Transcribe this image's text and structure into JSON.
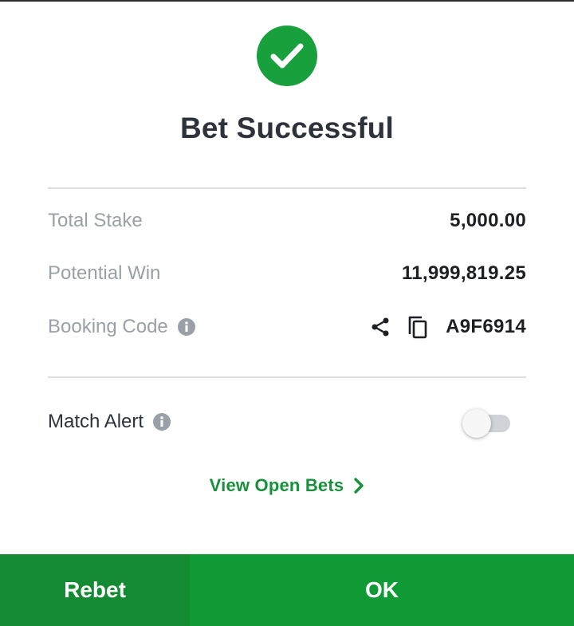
{
  "dialog": {
    "title": "Bet Successful",
    "status_icon": "check-circle-icon",
    "accent_color": "#17a03b"
  },
  "details": {
    "total_stake": {
      "label": "Total Stake",
      "value": "5,000.00"
    },
    "potential_win": {
      "label": "Potential Win",
      "value": "11,999,819.25"
    },
    "booking_code": {
      "label": "Booking Code",
      "info_icon": "info-icon",
      "share_icon": "share-icon",
      "copy_icon": "copy-icon",
      "value": "A9F6914"
    }
  },
  "match_alert": {
    "label": "Match Alert",
    "info_icon": "info-icon",
    "enabled": false
  },
  "view_open_bets": {
    "label": "View Open Bets",
    "icon": "chevron-right-icon"
  },
  "footer": {
    "rebet_label": "Rebet",
    "ok_label": "OK",
    "rebet_color": "#148a33",
    "ok_color": "#109a36"
  }
}
